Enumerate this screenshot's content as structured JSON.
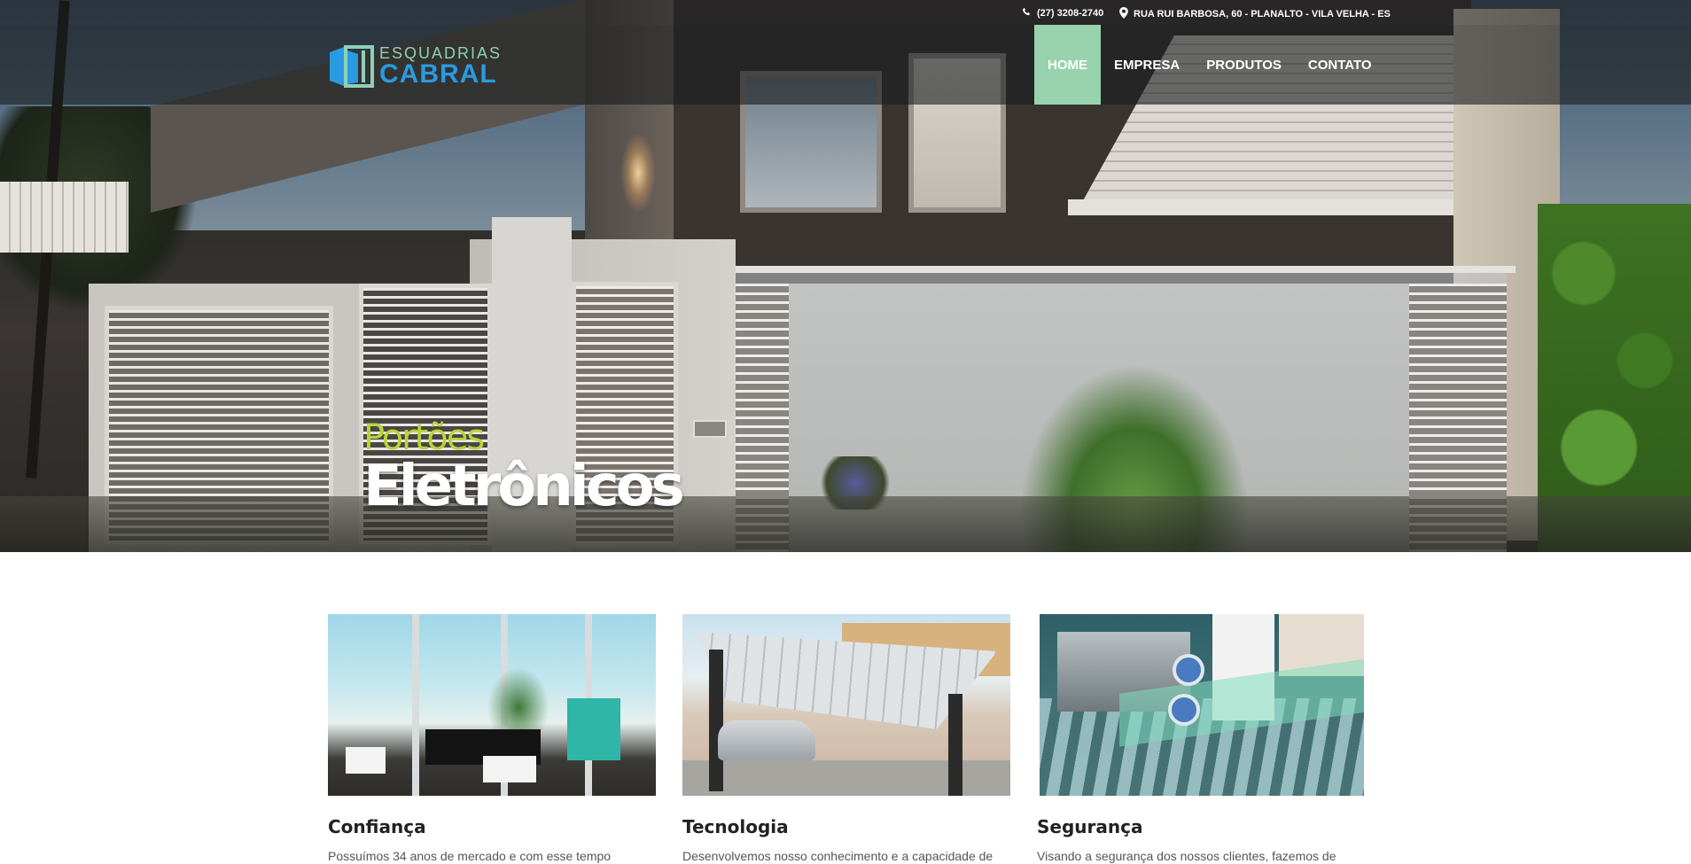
{
  "topbar": {
    "phone": "(27) 3208-2740",
    "phone_icon": "phone-icon",
    "address": "RUA RUI BARBOSA, 60 - PLANALTO - VILA VELHA - ES",
    "address_icon": "map-marker-icon"
  },
  "brand": {
    "line1": "ESQUADRIAS",
    "line2": "CABRAL",
    "colors": {
      "line1": "#8fd0b8",
      "line2": "#2a9be0"
    }
  },
  "nav": {
    "items": [
      {
        "label": "HOME",
        "active": true
      },
      {
        "label": "EMPRESA",
        "active": false
      },
      {
        "label": "PRODUTOS",
        "active": false
      },
      {
        "label": "CONTATO",
        "active": false
      }
    ],
    "active_color": "#98d3ad"
  },
  "hero": {
    "subtitle": "Portões",
    "title": "Eletrônicos",
    "subtitle_color": "#b8d438"
  },
  "features": [
    {
      "title": "Confiança",
      "text": "Possuímos 34 anos de mercado e com esse tempo"
    },
    {
      "title": "Tecnologia",
      "text": "Desenvolvemos nosso conhecimento e a capacidade de"
    },
    {
      "title": "Segurança",
      "text": "Visando a segurança dos nossos clientes, fazemos de"
    }
  ]
}
